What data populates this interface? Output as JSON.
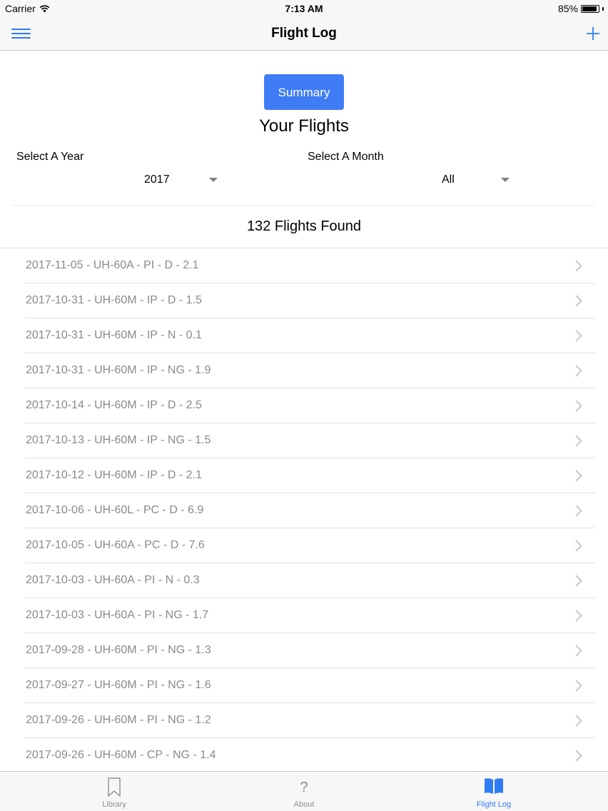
{
  "status_bar": {
    "carrier": "Carrier",
    "time": "7:13 AM",
    "battery": "85%"
  },
  "nav": {
    "title": "Flight Log",
    "menu_icon": "hamburger-menu-icon",
    "add_icon": "plus-icon"
  },
  "summary_button": "Summary",
  "heading": "Your Flights",
  "filters": {
    "year_label": "Select A Year",
    "year_value": "2017",
    "month_label": "Select A Month",
    "month_value": "All"
  },
  "count_text": "132 Flights Found",
  "flights": [
    "2017-11-05 - UH-60A - PI - D - 2.1",
    "2017-10-31 - UH-60M - IP - D - 1.5",
    "2017-10-31 - UH-60M - IP - N - 0.1",
    "2017-10-31 - UH-60M - IP - NG - 1.9",
    "2017-10-14 - UH-60M - IP - D - 2.5",
    "2017-10-13 - UH-60M - IP - NG - 1.5",
    "2017-10-12 - UH-60M - IP - D - 2.1",
    "2017-10-06 - UH-60L - PC - D - 6.9",
    "2017-10-05 - UH-60A - PC - D - 7.6",
    "2017-10-03 - UH-60A - PI - N - 0.3",
    "2017-10-03 - UH-60A - PI - NG - 1.7",
    "2017-09-28 - UH-60M - PI - NG - 1.3",
    "2017-09-27 - UH-60M - PI - NG - 1.6",
    "2017-09-26 - UH-60M - PI - NG - 1.2",
    "2017-09-26 - UH-60M - CP - NG - 1.4"
  ],
  "tabs": [
    {
      "label": "Library",
      "icon": "bookmark-icon",
      "active": false
    },
    {
      "label": "About",
      "icon": "question-mark-icon",
      "glyph": "?",
      "active": false
    },
    {
      "label": "Flight Log",
      "icon": "open-book-icon",
      "active": true
    }
  ],
  "colors": {
    "accent": "#2f7cf6",
    "button": "#3f7cf4",
    "list_text": "#8a8a8f",
    "inactive_tab": "#8e8e93"
  }
}
